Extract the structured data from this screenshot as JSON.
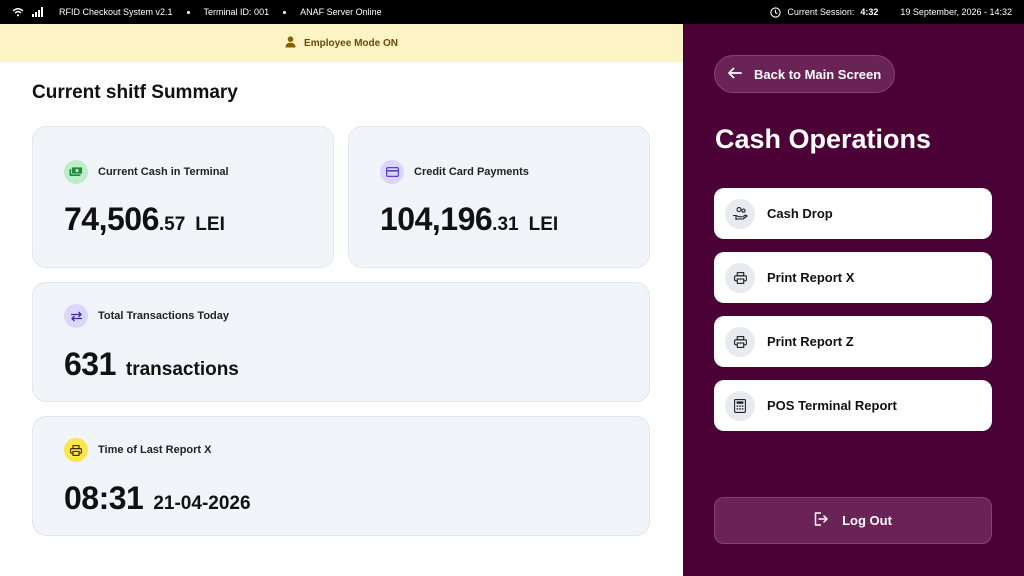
{
  "status_bar": {
    "system_name": "RFID Checkout System v2.1",
    "terminal_id": "Terminal ID: 001",
    "server_status": "ANAF Server Online",
    "session_label": "Current Session:",
    "session_time": "4:32",
    "datetime": "19 September, 2026 - 14:32"
  },
  "banner": {
    "text": "Employee Mode ON",
    "icon": "person-icon"
  },
  "summary": {
    "title": "Current shitf Summary",
    "cards": {
      "cash": {
        "label": "Current Cash in Terminal",
        "integer": "74,506",
        "decimal": ".57",
        "unit": "LEI",
        "icon": "cash-icon",
        "icon_bg": "#bdeec7"
      },
      "card": {
        "label": "Credit Card Payments",
        "integer": "104,196",
        "decimal": ".31",
        "unit": "LEI",
        "icon": "credit-card-icon",
        "icon_bg": "#dcd6fb"
      },
      "transactions": {
        "label": "Total Transactions Today",
        "value": "631",
        "unit": "transactions",
        "icon": "swap-arrows-icon",
        "icon_bg": "#dcd6fb"
      },
      "last_report": {
        "label": "Time of Last Report X",
        "time": "08:31",
        "date": "21-04-2026",
        "icon": "printer-icon",
        "icon_bg": "#fbe64d"
      }
    }
  },
  "operations": {
    "back_label": "Back to Main Screen",
    "title": "Cash Operations",
    "items": [
      {
        "label": "Cash Drop",
        "icon": "hand-coins-icon"
      },
      {
        "label": "Print Report X",
        "icon": "printer-icon"
      },
      {
        "label": "Print Report Z",
        "icon": "printer-icon"
      },
      {
        "label": "POS Terminal Report",
        "icon": "receipt-icon"
      }
    ],
    "logout_label": "Log Out"
  },
  "colors": {
    "sidebar_bg": "#4b0036",
    "sidebar_button": "#6a2357",
    "banner_bg": "#fdf4c6",
    "card_bg": "#f1f4f8"
  }
}
